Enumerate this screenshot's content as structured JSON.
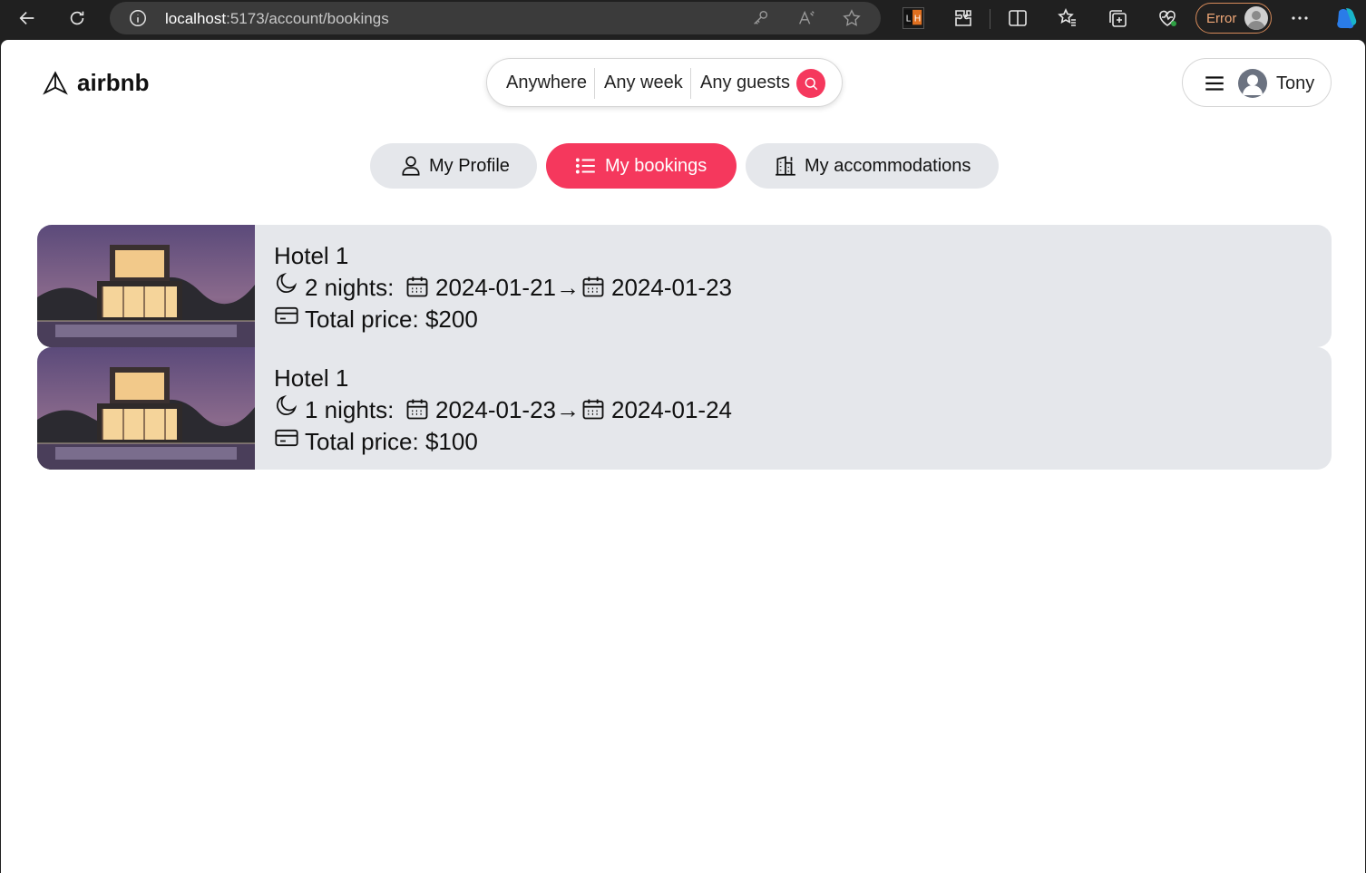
{
  "browser": {
    "url_host": "localhost",
    "url_path": ":5173/account/bookings",
    "profile_status": "Error"
  },
  "header": {
    "logo_text": "airbnb",
    "search": {
      "where": "Anywhere",
      "when": "Any week",
      "who": "Any guests"
    },
    "user_name": "Tony"
  },
  "tabs": [
    {
      "label": "My Profile",
      "icon": "user-icon",
      "active": false
    },
    {
      "label": "My bookings",
      "icon": "list-icon",
      "active": true
    },
    {
      "label": "My accommodations",
      "icon": "building-icon",
      "active": false
    }
  ],
  "bookings": [
    {
      "title": "Hotel 1",
      "nights": "2 nights:",
      "check_in": "2024-01-21",
      "arrow": "→",
      "check_out": "2024-01-23",
      "price": "Total price: $200"
    },
    {
      "title": "Hotel 1",
      "nights": "1 nights:",
      "check_in": "2024-01-23",
      "arrow": "→",
      "check_out": "2024-01-24",
      "price": "Total price: $100"
    }
  ],
  "colors": {
    "accent": "#f5385d",
    "card_bg": "#e5e7eb",
    "chrome_bg": "#202020"
  }
}
